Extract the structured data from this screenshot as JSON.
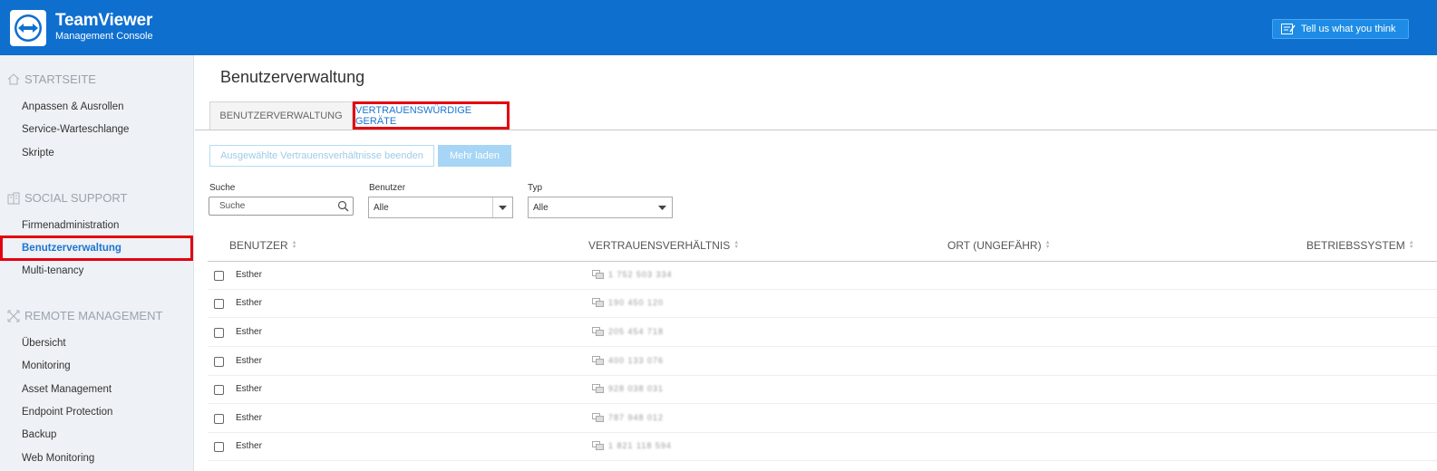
{
  "header": {
    "brand_name": "TeamViewer",
    "brand_sub": "Management Console",
    "feedback_label": "Tell us what you think",
    "bg_color": "#0e6fcf"
  },
  "sidebar": {
    "sections": [
      {
        "title": "STARTSEITE",
        "icon": "home-icon",
        "items": [
          "Anpassen & Ausrollen",
          "Service-Warteschlange",
          "Skripte"
        ]
      },
      {
        "title": "SOCIAL SUPPORT",
        "icon": "building-icon",
        "items": [
          "Firmenadministration",
          "Benutzerverwaltung",
          "Multi-tenancy"
        ]
      },
      {
        "title": "REMOTE MANAGEMENT",
        "icon": "arrows-icon",
        "items": [
          "Übersicht",
          "Monitoring",
          "Asset Management",
          "Endpoint Protection",
          "Backup",
          "Web Monitoring"
        ]
      }
    ],
    "active_item": "Benutzerverwaltung",
    "highlight_color": "#e3000f"
  },
  "main": {
    "title": "Benutzerverwaltung",
    "tabs": [
      "BENUTZERVERWALTUNG",
      "VERTRAUENSWÜRDIGE GERÄTE"
    ],
    "active_tab": "VERTRAUENSWÜRDIGE GERÄTE",
    "buttons": {
      "end_trust": "Ausgewählte Vertrauensverhältnisse beenden",
      "load_more": "Mehr laden"
    },
    "filters": {
      "search_label": "Suche",
      "search_placeholder": "Suche",
      "user_label": "Benutzer",
      "user_value": "Alle",
      "type_label": "Typ",
      "type_value": "Alle"
    },
    "table": {
      "columns": [
        "BENUTZER",
        "VERTRAUENSVERHÄLTNIS",
        "ORT (UNGEFÄHR)",
        "BETRIEBSSYSTEM"
      ],
      "rows": [
        {
          "user": "Esther",
          "trust": "1 752 503 334"
        },
        {
          "user": "Esther",
          "trust": "190 450 120"
        },
        {
          "user": "Esther",
          "trust": "205 454 718"
        },
        {
          "user": "Esther",
          "trust": "400 133 076"
        },
        {
          "user": "Esther",
          "trust": "928 038 031"
        },
        {
          "user": "Esther",
          "trust": "787 948 012"
        },
        {
          "user": "Esther",
          "trust": "1 821 118 594"
        }
      ]
    }
  }
}
